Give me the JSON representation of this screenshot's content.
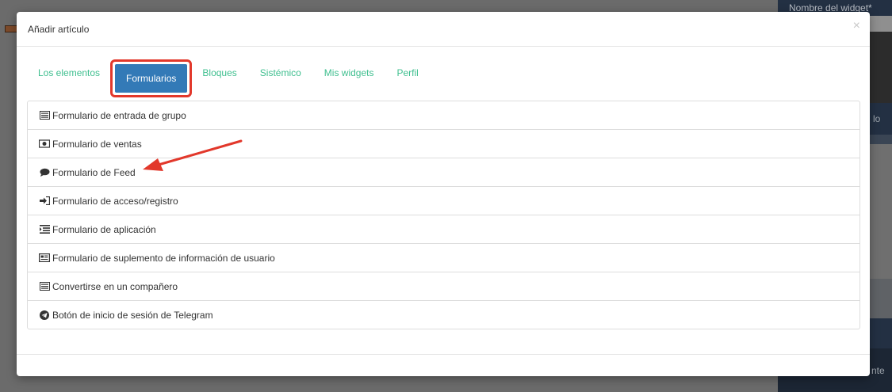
{
  "background": {
    "widget_name_label": "Nombre del widget*",
    "partial_text_1": "lo",
    "partial_text_2": "nte"
  },
  "modal": {
    "title": "Añadir artículo",
    "close_symbol": "×"
  },
  "tabs": [
    {
      "label": "Los elementos",
      "active": false
    },
    {
      "label": "Formularios",
      "active": true
    },
    {
      "label": "Bloques",
      "active": false
    },
    {
      "label": "Sistémico",
      "active": false
    },
    {
      "label": "Mis widgets",
      "active": false
    },
    {
      "label": "Perfil",
      "active": false
    }
  ],
  "items": [
    {
      "label": "Formulario de entrada de grupo",
      "icon": "list-icon"
    },
    {
      "label": "Formulario de ventas",
      "icon": "money-icon"
    },
    {
      "label": "Formulario de Feed",
      "icon": "comment-icon"
    },
    {
      "label": "Formulario de acceso/registro",
      "icon": "sign-in-icon"
    },
    {
      "label": "Formulario de aplicación",
      "icon": "indent-list-icon"
    },
    {
      "label": "Formulario de suplemento de información de usuario",
      "icon": "newspaper-icon"
    },
    {
      "label": "Convertirse en un compañero",
      "icon": "list-alt-icon"
    },
    {
      "label": "Botón de inicio de sesión de Telegram",
      "icon": "telegram-icon"
    }
  ],
  "colors": {
    "tab_text": "#3fbf8f",
    "tab_active_bg": "#337ab7",
    "highlight_red": "#e2382b"
  }
}
